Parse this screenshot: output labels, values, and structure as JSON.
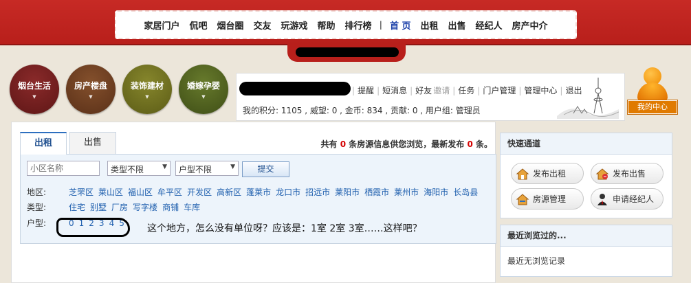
{
  "nav": {
    "items": [
      "家居门户",
      "侃吧",
      "烟台圈",
      "交友",
      "玩游戏",
      "帮助",
      "排行榜"
    ],
    "separator": "|",
    "right_items": [
      "首 页",
      "出租",
      "出售",
      "经纪人",
      "房产中介"
    ]
  },
  "categories": [
    {
      "label": "烟台生活",
      "color": "#6e1c1c"
    },
    {
      "label": "房产楼盘",
      "color": "#6a3a1e"
    },
    {
      "label": "装饰建材",
      "color": "#6b6b1c"
    },
    {
      "label": "婚嫁孕婴",
      "color": "#4d5e1d"
    }
  ],
  "user": {
    "links": [
      "提醒",
      "短消息",
      "好友",
      "邀请",
      "任务",
      "门户管理",
      "管理中心",
      "退出"
    ],
    "stats": "我的积分: 1105 , 威望: 0 , 金币: 834 , 贡献: 0 , 用户组: 管理员",
    "my_center": "我的中心"
  },
  "main": {
    "tabs": [
      "出租",
      "出售"
    ],
    "summary_prefix": "共有",
    "summary_count": "0",
    "summary_middle": "条房源信息供您浏览，最新发布",
    "summary_latest": "0",
    "summary_suffix": "条。",
    "search_placeholder": "小区名称",
    "type_select": "类型不限",
    "layout_select": "户型不限",
    "submit": "提交",
    "area_label": "地区:",
    "areas": [
      "芝罘区",
      "莱山区",
      "福山区",
      "牟平区",
      "开发区",
      "高新区",
      "蓬莱市",
      "龙口市",
      "招远市",
      "莱阳市",
      "栖霞市",
      "莱州市",
      "海阳市",
      "长岛县"
    ],
    "type_label": "类型:",
    "types": [
      "住宅",
      "别墅",
      "厂房",
      "写字楼",
      "商铺",
      "车库"
    ],
    "layout_label": "户型:",
    "layouts": [
      "0",
      "1",
      "2",
      "3",
      "4",
      "5"
    ],
    "annotation": "这个地方，怎么没有单位呀？应该是：1室 2室 3室……这样吧？"
  },
  "sidebar": {
    "quick_title": "快速通道",
    "quick_buttons": [
      "发布出租",
      "发布出售",
      "房源管理",
      "申请经纪人"
    ],
    "recent_title": "最近浏览过的...",
    "recent_empty": "最近无浏览记录"
  }
}
